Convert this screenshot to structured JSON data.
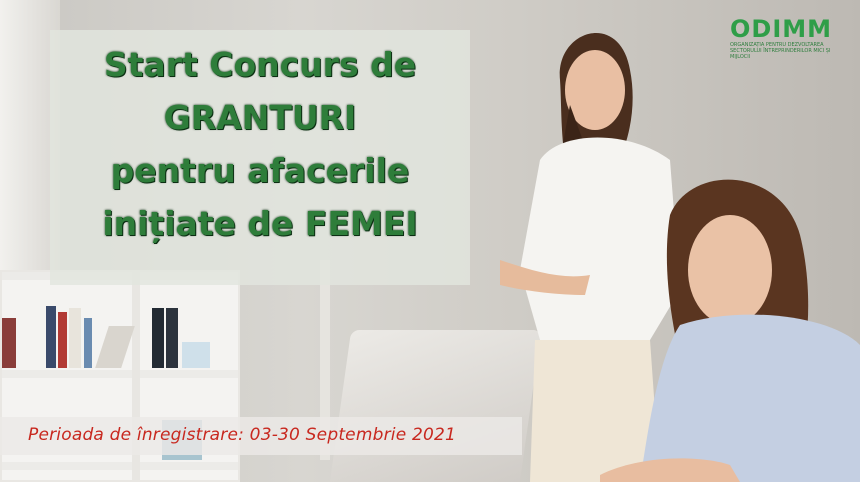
{
  "headline": {
    "line1": "Start Concurs de",
    "line2": "GRANTURI",
    "line3": "pentru afacerile",
    "line4": "inițiate de FEMEI"
  },
  "registration": "Perioada de înregistrare: 03-30 Septembrie 2021",
  "logo": {
    "mark": "ODIMM",
    "subtitle": "ORGANIZAȚIA PENTRU DEZVOLTAREA SECTORULUI ÎNTREPRINDERILOR MICI ȘI MIJLOCII"
  },
  "colors": {
    "headline": "#2e7d3a",
    "registration": "#c8281f",
    "logo": "#2f9e48"
  }
}
